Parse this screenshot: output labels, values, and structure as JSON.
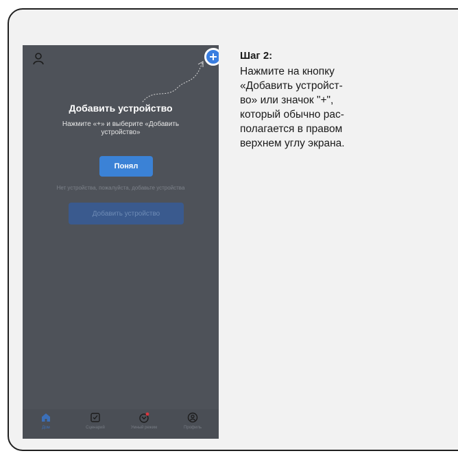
{
  "phone": {
    "overlay": {
      "title": "Добавить устройство",
      "subtitle": "Нажмите «+» и выберите «Добавить устройство»",
      "ok_button": "Понял"
    },
    "empty_text": "Нет устройства, пожалуйста, добавьте устройства",
    "add_device_button": "Добавить устройство",
    "tabs": [
      {
        "label": "Дом",
        "icon": "home-icon",
        "active": true
      },
      {
        "label": "Сценарий",
        "icon": "scenario-icon",
        "active": false
      },
      {
        "label": "Умный режим",
        "icon": "smart-mode-icon",
        "active": false
      },
      {
        "label": "Профиль",
        "icon": "profile-icon",
        "active": false
      }
    ]
  },
  "instruction": {
    "title": "Шаг 2:",
    "lines": [
      "Нажмите на кнопку",
      "«Добавить устройст-",
      "во» или значок \"+\",",
      "который обычно рас-",
      "полагается в правом",
      "верхнем углу экрана."
    ]
  },
  "colors": {
    "accent": "#3a7ee0",
    "phone_bg": "#4e5259",
    "card_bg": "#f2f2f2"
  }
}
